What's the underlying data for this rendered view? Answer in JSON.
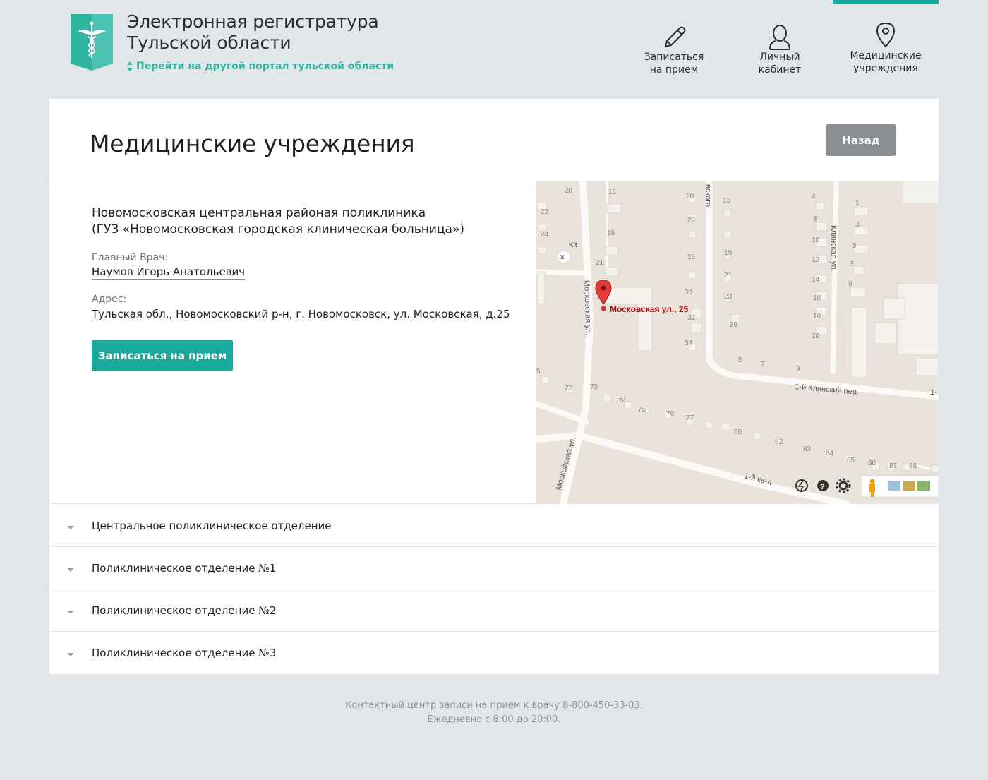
{
  "header": {
    "title_line1": "Электронная регистратура",
    "title_line2": "Тульской области",
    "portal_link": "Перейти на другой портал тульской области"
  },
  "nav": [
    {
      "label": "Записаться\nна прием",
      "icon": "pencil-icon"
    },
    {
      "label": "Личный\nкабинет",
      "icon": "user-icon"
    },
    {
      "label": "Медицинские\nучреждения",
      "icon": "map-pin-icon",
      "active": true
    }
  ],
  "page": {
    "title": "Медицинские учреждения",
    "back_label": "Назад"
  },
  "org": {
    "name_line1": "Новомосковская центральная районая поликлиника",
    "name_line2": "(ГУЗ «Новомосковская городская клиническая больница»)",
    "doctor_label": "Главный Врач:",
    "doctor_name": "Наумов Игорь Анатольевич",
    "address_label": "Адрес:",
    "address": "Тульская обл., Новомосковский р-н, г. Новомосковск, ул. Московская, д.25",
    "book_label": "Записаться на прием"
  },
  "map": {
    "marker_label": "Московская ул., 25",
    "streets": [
      "Московская ул.",
      "1-й Клинский пер.",
      "Клинская ул.",
      "1-й кв-л",
      "Kit"
    ],
    "house_numbers": [
      "20",
      "15",
      "22",
      "24",
      "19",
      "21",
      "20",
      "22",
      "26",
      "30",
      "32",
      "34",
      "13",
      "19",
      "21",
      "23",
      "29",
      "4",
      "8",
      "10",
      "12",
      "14",
      "16",
      "18",
      "20",
      "1",
      "3",
      "5",
      "7",
      "9",
      "5",
      "7",
      "9",
      "72",
      "73",
      "74",
      "75",
      "76",
      "77",
      "80",
      "82",
      "83",
      "84",
      "85",
      "86",
      "87",
      "88"
    ],
    "accent_color": "#e53935"
  },
  "departments": [
    "Центральное поликлиническое отделение",
    "Поликлиническое отделение №1",
    "Поликлиническое отделение №2",
    "Поликлиническое отделение №3"
  ],
  "footer": {
    "line1": "Контактный центр записи на прием к врачу 8-800-450-33-03.",
    "line2": "Ежедневно с 8:00 до 20:00."
  },
  "colors": {
    "accent": "#1aa99c",
    "link": "#2fb4a2",
    "background": "#e1e6e8",
    "back_button": "#8a8f94"
  }
}
